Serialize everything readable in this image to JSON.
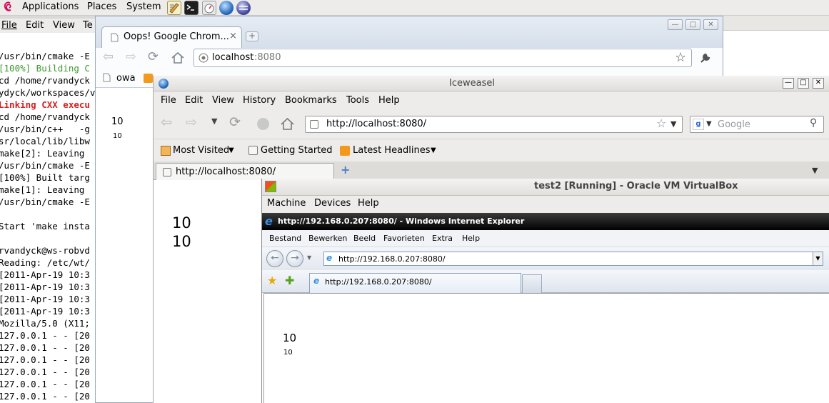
{
  "panel": {
    "menus": [
      "Applications",
      "Places",
      "System"
    ],
    "colors": {
      "bg": "#edeceb",
      "debian_red": "#d70751"
    }
  },
  "terminal": {
    "menu": [
      "File",
      "Edit",
      "View",
      "Te"
    ],
    "lines": [
      {
        "text": "/usr/bin/cmake -E",
        "color": "#000000",
        "bold": false
      },
      {
        "text": "[100%] Building C",
        "color": "#3d9a2f",
        "bold": false
      },
      {
        "text": "cd /home/rvandyck",
        "color": "#000000",
        "bold": false
      },
      {
        "text": "ydyck/workspaces/v",
        "color": "#000000",
        "bold": false
      },
      {
        "text": "Linking CXX execu",
        "color": "#d42020",
        "bold": true
      },
      {
        "text": "cd /home/rvandyck",
        "color": "#000000",
        "bold": false
      },
      {
        "text": "/usr/bin/c++   -g",
        "color": "#000000",
        "bold": false
      },
      {
        "text": "sr/local/lib/libw",
        "color": "#000000",
        "bold": false
      },
      {
        "text": "make[2]: Leaving",
        "color": "#000000",
        "bold": false
      },
      {
        "text": "/usr/bin/cmake -E",
        "color": "#000000",
        "bold": false
      },
      {
        "text": "[100%] Built targ",
        "color": "#000000",
        "bold": false
      },
      {
        "text": "make[1]: Leaving",
        "color": "#000000",
        "bold": false
      },
      {
        "text": "/usr/bin/cmake -E",
        "color": "#000000",
        "bold": false
      },
      {
        "text": "",
        "color": "#000000",
        "bold": false
      },
      {
        "text": "Start 'make insta",
        "color": "#000000",
        "bold": false
      },
      {
        "text": "",
        "color": "#000000",
        "bold": false
      },
      {
        "text": "rvandyck@ws-robvd",
        "color": "#000000",
        "bold": false
      },
      {
        "text": "Reading: /etc/wt/",
        "color": "#000000",
        "bold": false
      },
      {
        "text": "[2011-Apr-19 10:3",
        "color": "#000000",
        "bold": false
      },
      {
        "text": "[2011-Apr-19 10:3",
        "color": "#000000",
        "bold": false
      },
      {
        "text": "[2011-Apr-19 10:3",
        "color": "#000000",
        "bold": false
      },
      {
        "text": "[2011-Apr-19 10:3",
        "color": "#000000",
        "bold": false
      },
      {
        "text": "Mozilla/5.0 (X11;",
        "color": "#000000",
        "bold": false
      },
      {
        "text": "127.0.0.1 - - [20",
        "color": "#000000",
        "bold": false
      },
      {
        "text": "127.0.0.1 - - [20",
        "color": "#000000",
        "bold": false
      },
      {
        "text": "127.0.0.1 - - [20",
        "color": "#000000",
        "bold": false
      },
      {
        "text": "127.0.0.1 - - [20",
        "color": "#000000",
        "bold": false
      },
      {
        "text": "127.0.0.1 - - [20",
        "color": "#000000",
        "bold": false
      },
      {
        "text": "127.0.0.1 - - [20",
        "color": "#000000",
        "bold": false
      },
      {
        "text": "127.0.0.1 - - [20",
        "color": "#000000",
        "bold": false
      }
    ]
  },
  "chrome": {
    "tab_title": "Oops! Google Chrom...",
    "tab_close": "×",
    "new_tab": "+",
    "url_host": "localhost",
    "url_port": ":8080",
    "bookmarks": [
      "owa"
    ],
    "content": [
      "10",
      "10"
    ]
  },
  "iceweasel": {
    "title": "Iceweasel",
    "menu": [
      "File",
      "Edit",
      "View",
      "History",
      "Bookmarks",
      "Tools",
      "Help"
    ],
    "url": "http://localhost:8080/",
    "search_placeholder": "Google",
    "bookmarks": [
      "Most Visited",
      "Getting Started",
      "Latest Headlines"
    ],
    "tab_title": "http://localhost:8080/",
    "new_tab": "+",
    "content": [
      "10",
      "10"
    ]
  },
  "vbox": {
    "title": "test2 [Running] - Oracle VM VirtualBox",
    "menu": [
      "Machine",
      "Devices",
      "Help"
    ],
    "ie": {
      "title": "http://192.168.0.207:8080/ - Windows Internet Explorer",
      "menu": [
        "Bestand",
        "Bewerken",
        "Beeld",
        "Favorieten",
        "Extra",
        "Help"
      ],
      "url": "http://192.168.0.207:8080/",
      "tab_title": "http://192.168.0.207:8080/",
      "content": [
        "10",
        "10"
      ]
    }
  }
}
